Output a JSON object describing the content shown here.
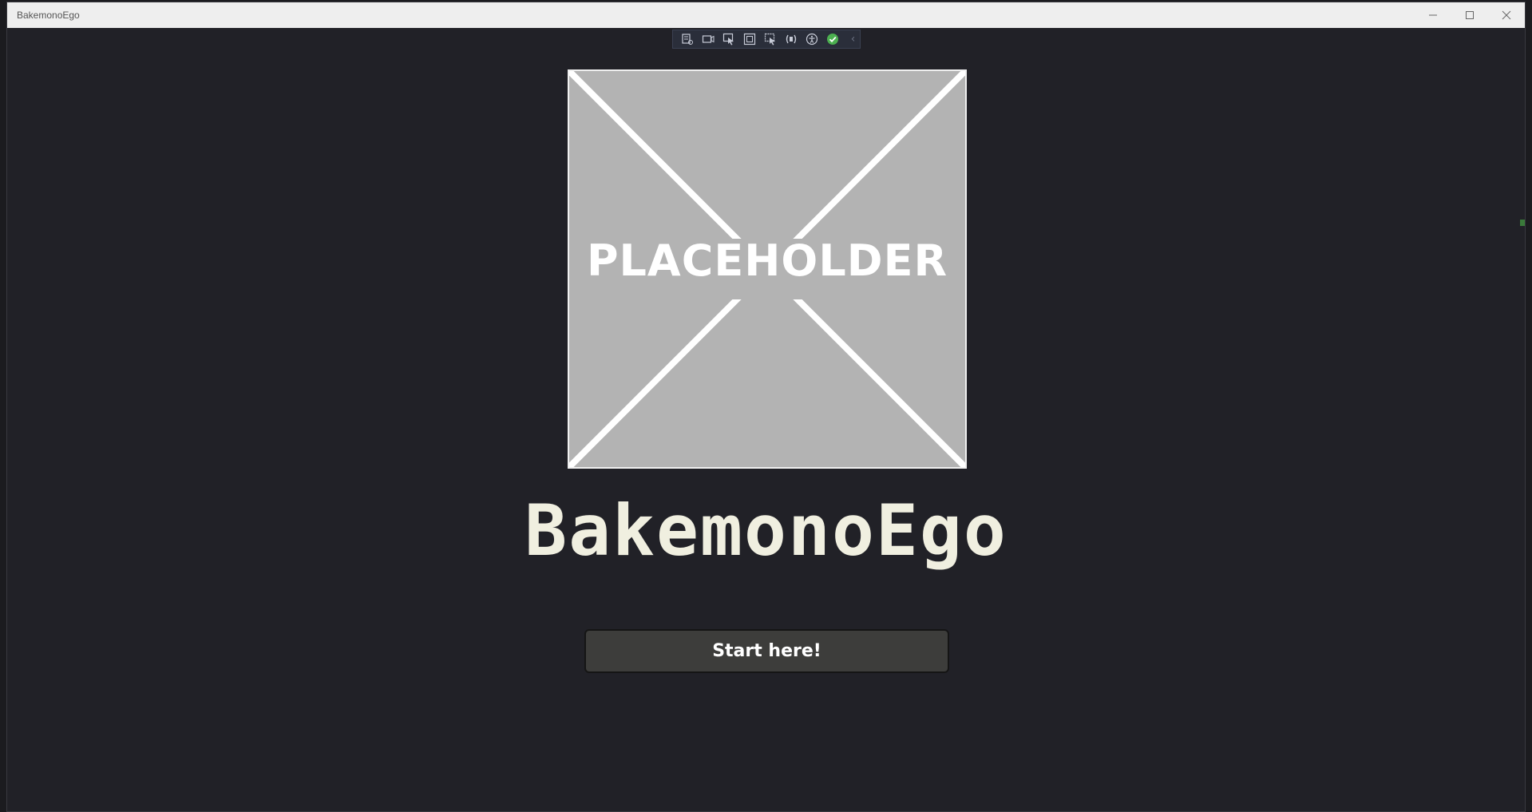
{
  "window": {
    "title": "BakemonoEgo",
    "controls": {
      "minimize": "—",
      "maximize": "☐",
      "close": "✕"
    }
  },
  "debug_toolbar": {
    "icons": [
      "live-visual-tree-icon",
      "video-capture-icon",
      "select-element-icon",
      "display-layout-adorners-icon",
      "track-focus-icon",
      "binding-failures-icon",
      "accessibility-icon",
      "check-ok-icon",
      "collapse-chevron-icon"
    ],
    "collapse_glyph": "‹"
  },
  "hero": {
    "placeholder_label": "PLACEHOLDER"
  },
  "app_title": "BakemonoEgo",
  "start_button": {
    "label": "Start here!"
  },
  "colors": {
    "background": "#212127",
    "title_text": "#f0efe0",
    "button_bg": "#3d3d3b",
    "placeholder_bg": "#b3b3b3"
  }
}
